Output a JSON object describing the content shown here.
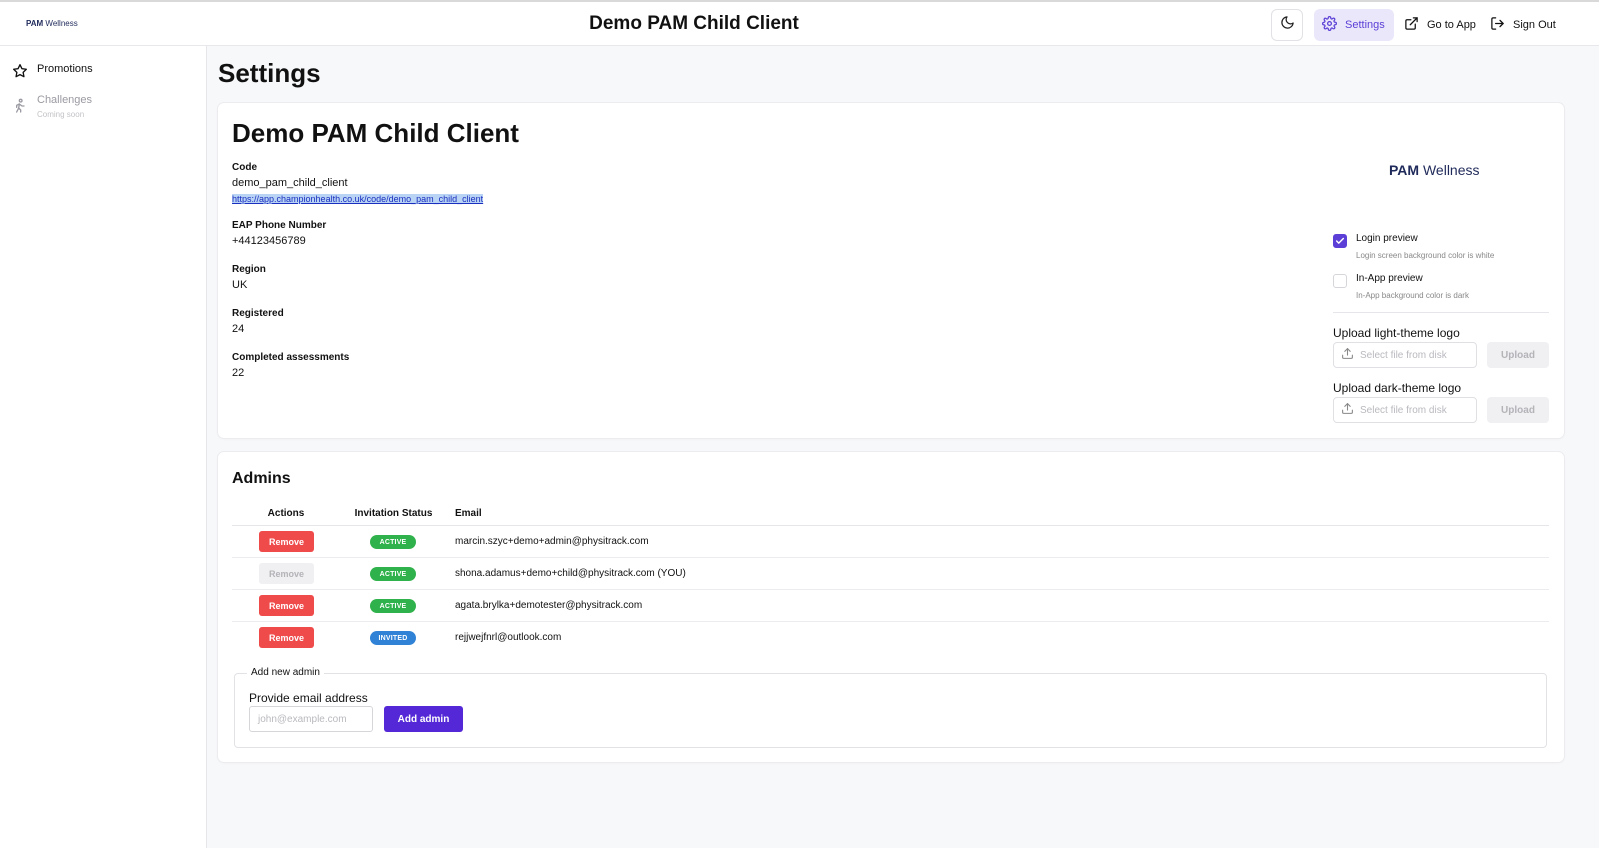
{
  "header": {
    "logo_bold": "PAM",
    "logo_rest": "Wellness",
    "title": "Demo PAM Child Client",
    "theme_icon": "moon-icon",
    "nav": {
      "settings": "Settings",
      "go_to_app": "Go to App",
      "sign_out": "Sign Out"
    }
  },
  "sidebar": {
    "items": [
      {
        "label": "Promotions",
        "sub": "",
        "icon": "star-icon"
      },
      {
        "label": "Challenges",
        "sub": "Coming soon",
        "icon": "walking-icon"
      }
    ]
  },
  "page": {
    "title": "Settings"
  },
  "client": {
    "name": "Demo PAM Child Client",
    "code_label": "Code",
    "code": "demo_pam_child_client",
    "link": "https://app.championhealth.co.uk/code/demo_pam_child_client",
    "eap_label": "EAP Phone Number",
    "eap": "+44123456789",
    "region_label": "Region",
    "region": "UK",
    "registered_label": "Registered",
    "registered": "24",
    "completed_label": "Completed assessments",
    "completed": "22"
  },
  "branding": {
    "logo_bold": "PAM",
    "logo_rest": "Wellness",
    "login_preview": {
      "label": "Login preview",
      "desc": "Login screen background color is white",
      "checked": true
    },
    "inapp_preview": {
      "label": "In-App preview",
      "desc": "In-App background color is dark",
      "checked": false
    },
    "light_logo": {
      "label": "Upload light-theme logo",
      "placeholder": "Select file from disk",
      "button": "Upload"
    },
    "dark_logo": {
      "label": "Upload dark-theme logo",
      "placeholder": "Select file from disk",
      "button": "Upload"
    }
  },
  "admins": {
    "title": "Admins",
    "columns": [
      "Actions",
      "Invitation Status",
      "Email"
    ],
    "rows": [
      {
        "action": "Remove",
        "action_enabled": true,
        "status": "ACTIVE",
        "email": "marcin.szyc+demo+admin@physitrack.com"
      },
      {
        "action": "Remove",
        "action_enabled": false,
        "status": "ACTIVE",
        "email": "shona.adamus+demo+child@physitrack.com (YOU)"
      },
      {
        "action": "Remove",
        "action_enabled": true,
        "status": "ACTIVE",
        "email": "agata.brylka+demotester@physitrack.com"
      },
      {
        "action": "Remove",
        "action_enabled": true,
        "status": "INVITED",
        "email": "rejjwejfnrl@outlook.com"
      }
    ],
    "add": {
      "legend": "Add new admin",
      "label": "Provide email address",
      "placeholder": "john@example.com",
      "button": "Add admin"
    }
  },
  "colors": {
    "accent": "#5b3fd6",
    "danger": "#ef4b4b",
    "active": "#2fb14c",
    "invited": "#2f82d6"
  }
}
